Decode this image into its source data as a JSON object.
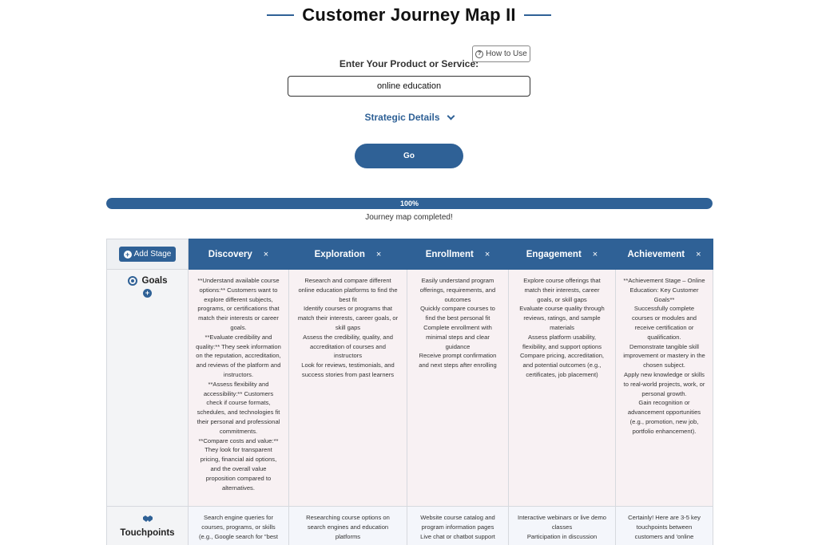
{
  "header": {
    "title": "Customer Journey Map II"
  },
  "how_to_use": {
    "label": "How to Use"
  },
  "product": {
    "label": "Enter Your Product or Service:",
    "value": "online education"
  },
  "strategic_details": {
    "label": "Strategic Details"
  },
  "go_button": {
    "label": "Go"
  },
  "progress": {
    "percent_label": "100%",
    "value": 1.0,
    "status": "Journey map completed!"
  },
  "table": {
    "add_stage_label": "Add Stage",
    "stages": [
      {
        "name": "Discovery",
        "remove": "×"
      },
      {
        "name": "Exploration",
        "remove": "×"
      },
      {
        "name": "Enrollment",
        "remove": "×"
      },
      {
        "name": "Engagement",
        "remove": "×"
      },
      {
        "name": "Achievement",
        "remove": "×"
      }
    ],
    "rows": {
      "goals": {
        "label": "Goals",
        "cells": [
          [
            "**Understand available course options:** Customers want to explore different subjects, programs, or certifications that match their interests or career goals.",
            "**Evaluate credibility and quality:** They seek information on the reputation, accreditation, and reviews of the platform and instructors.",
            "**Assess flexibility and accessibility:** Customers check if course formats, schedules, and technologies fit their personal and professional commitments.",
            "**Compare costs and value:** They look for transparent pricing, financial aid options, and the overall value proposition compared to alternatives."
          ],
          [
            "Research and compare different online education platforms to find the best fit",
            "Identify courses or programs that match their interests, career goals, or skill gaps",
            "Assess the credibility, quality, and accreditation of courses and instructors",
            "Look for reviews, testimonials, and success stories from past learners"
          ],
          [
            "Easily understand program offerings, requirements, and outcomes",
            "Quickly compare courses to find the best personal fit",
            "Complete enrollment with minimal steps and clear guidance",
            "Receive prompt confirmation and next steps after enrolling"
          ],
          [
            "Explore course offerings that match their interests, career goals, or skill gaps",
            "Evaluate course quality through reviews, ratings, and sample materials",
            "Assess platform usability, flexibility, and support options",
            "Compare pricing, accreditation, and potential outcomes (e.g., certificates, job placement)"
          ],
          [
            "**Achievement Stage – Online Education: Key Customer Goals**",
            "Successfully complete courses or modules and receive certification or qualification.",
            "Demonstrate tangible skill improvement or mastery in the chosen subject.",
            "Apply new knowledge or skills to real-world projects, work, or personal growth.",
            "Gain recognition or advancement opportunities (e.g., promotion, new job, portfolio enhancement)."
          ]
        ]
      },
      "touchpoints": {
        "label": "Touchpoints",
        "cells": [
          [
            "Search engine queries for courses, programs, or skills (e.g., Google search for \"best"
          ],
          [
            "Researching course options on search engines and education platforms"
          ],
          [
            "Website course catalog and program information pages",
            "Live chat or chatbot support"
          ],
          [
            "Interactive webinars or live demo classes",
            "Participation in discussion"
          ],
          [
            "Certainly! Here are 3-5 key touchpoints between customers and 'online"
          ]
        ]
      }
    }
  }
}
